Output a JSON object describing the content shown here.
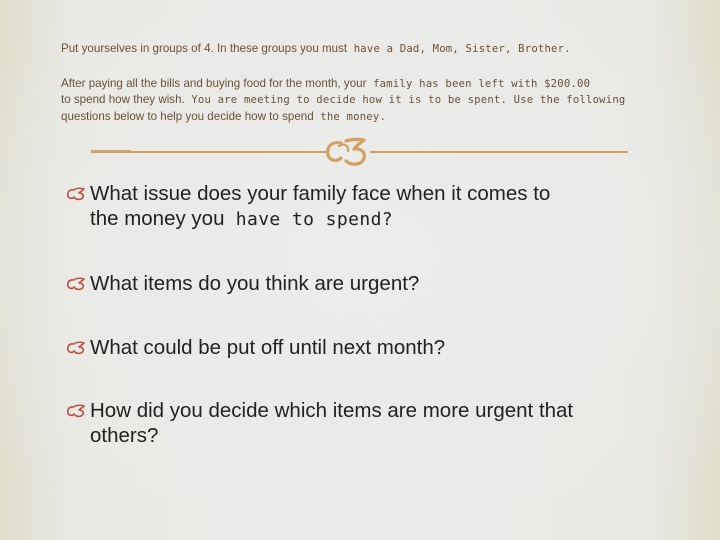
{
  "intro": {
    "line1_prop": "Put yourselves in groups of 4.  In these groups you must",
    "line1_mono": " have a Dad, Mom, Sister, Brother.",
    "line2_prop": "After paying all the bills and buying food for the month, your",
    "line2_mono": "  family has been left with $200.00",
    "line3_prop": "to spend how they wish.",
    "line3_mono": "  You are meeting to decide how it is to be spent.  Use the  following",
    "line4_prop": "questions below to help you decide how to spend",
    "line4_mono": "  the money."
  },
  "divider": {
    "ornament_icon": "fleuron-ornament-icon",
    "color": "#d4a060"
  },
  "questions": {
    "bullet_icon": "fleuron-bullet-icon",
    "bullet_color": "#c0503c",
    "items": [
      {
        "text": "What issue does your family face when it comes to",
        "cont_prop": "the money you",
        "cont_mono": "  have to spend?"
      },
      {
        "text": "What items do you think are urgent?"
      },
      {
        "text": "What could be put off until next month?"
      },
      {
        "text": "How did you decide which items are more urgent that",
        "cont_prop": "others?"
      }
    ]
  }
}
